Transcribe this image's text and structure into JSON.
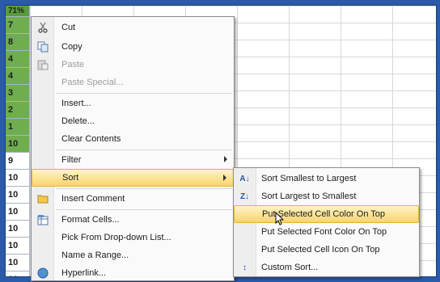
{
  "sheet": {
    "top_row_label": "71%",
    "row_labels": [
      "7",
      "8",
      "4",
      "4",
      "3",
      "2",
      "1",
      "10",
      "9",
      "10",
      "10",
      "10",
      "10",
      "10",
      "10",
      "10"
    ]
  },
  "menu": {
    "items": [
      {
        "label": "Cut",
        "icon": "scissors-icon",
        "disabled": false
      },
      {
        "label": "Copy",
        "icon": "copy-icon",
        "disabled": false
      },
      {
        "label": "Paste",
        "icon": "paste-icon",
        "disabled": true
      },
      {
        "label": "Paste Special...",
        "icon": "",
        "disabled": true
      },
      {
        "label": "Insert...",
        "icon": "",
        "disabled": false
      },
      {
        "label": "Delete...",
        "icon": "",
        "disabled": false
      },
      {
        "label": "Clear Contents",
        "icon": "",
        "disabled": false
      },
      {
        "label": "Filter",
        "icon": "",
        "disabled": false,
        "submenu": true
      },
      {
        "label": "Sort",
        "icon": "",
        "disabled": false,
        "submenu": true,
        "highlighted": true
      },
      {
        "label": "Insert Comment",
        "icon": "comment-folder-icon",
        "disabled": false
      },
      {
        "label": "Format Cells...",
        "icon": "format-cells-icon",
        "disabled": false
      },
      {
        "label": "Pick From Drop-down List...",
        "icon": "",
        "disabled": false
      },
      {
        "label": "Name a Range...",
        "icon": "",
        "disabled": false
      },
      {
        "label": "Hyperlink...",
        "icon": "hyperlink-globe-icon",
        "disabled": false
      }
    ]
  },
  "submenu": {
    "items": [
      {
        "label": "Sort Smallest to Largest",
        "icon": "sort-ascending-icon",
        "icon_text": "A↓"
      },
      {
        "label": "Sort Largest to Smallest",
        "icon": "sort-descending-icon",
        "icon_text": "Z↓"
      },
      {
        "label": "Put Selected Cell Color On Top",
        "icon": "",
        "icon_text": "",
        "highlighted": true
      },
      {
        "label": "Put Selected Font Color On Top",
        "icon": "",
        "icon_text": ""
      },
      {
        "label": "Put Selected Cell Icon On Top",
        "icon": "",
        "icon_text": ""
      },
      {
        "label": "Custom Sort...",
        "icon": "custom-sort-icon",
        "icon_text": "↕"
      }
    ]
  },
  "colors": {
    "highlight": "#fbd46b",
    "green_cells": "#6fae4f",
    "frame": "#2a5aa8"
  }
}
